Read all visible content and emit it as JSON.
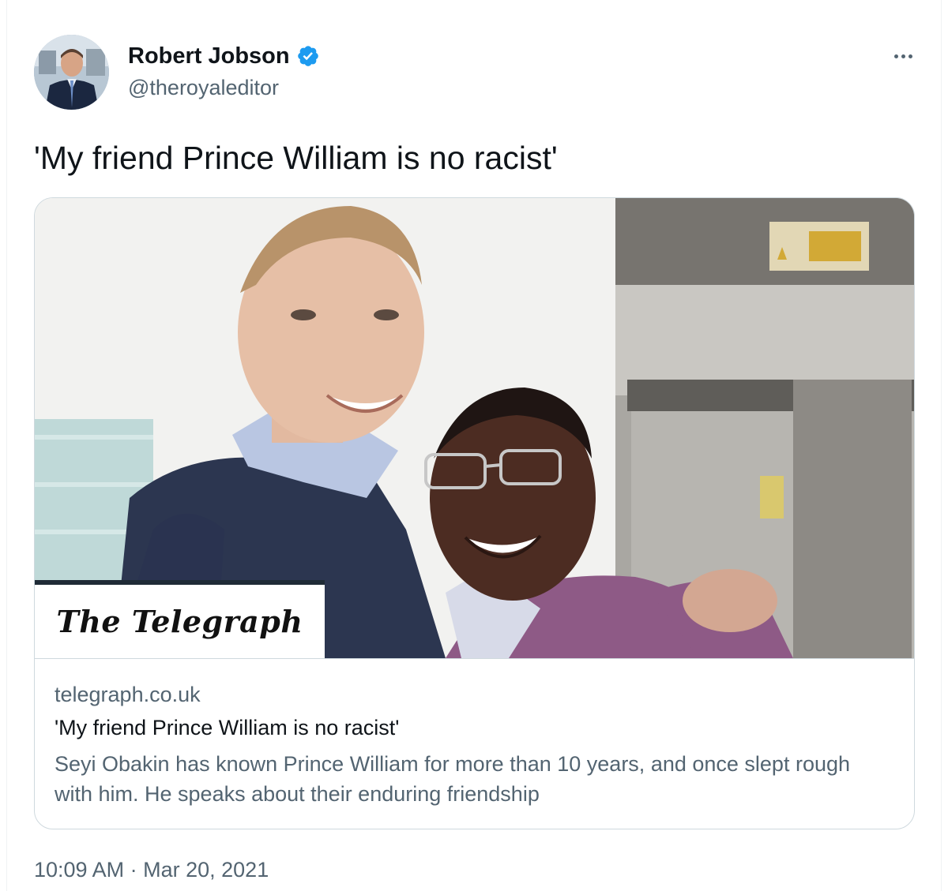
{
  "author": {
    "name": "Robert Jobson",
    "handle": "@theroyaleditor",
    "verified": true,
    "avatar_icon": "profile-photo"
  },
  "menu": {
    "more_icon": "more-horizontal-icon"
  },
  "tweet": {
    "text": "'My friend Prince William is no racist'"
  },
  "link_card": {
    "image_description_icon": "article-photo",
    "logo_text": "The Telegraph",
    "domain": "telegraph.co.uk",
    "title": "'My friend Prince William is no racist'",
    "description": "Seyi Obakin has known Prince William for more than 10 years, and once slept rough with him. He speaks about their enduring friendship"
  },
  "meta": {
    "time": "10:09 AM",
    "separator": "·",
    "date": "Mar 20, 2021"
  },
  "colors": {
    "text_primary": "#0f1419",
    "text_secondary": "#536471",
    "border": "#cfd9de",
    "verified_blue": "#1d9bf0"
  }
}
